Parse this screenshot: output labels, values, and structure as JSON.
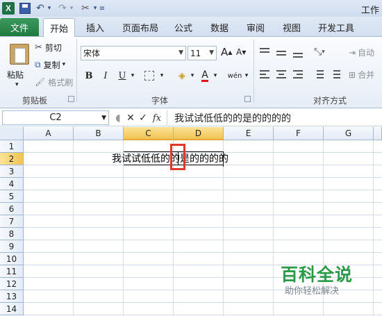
{
  "window": {
    "title": "工作"
  },
  "app_icon": "excel-logo",
  "quick_access": {
    "save": "save-icon",
    "undo": "undo-icon",
    "redo": "redo-icon",
    "tools": "tools-icon",
    "customize": "customize-icon"
  },
  "tabs": [
    {
      "label": "文件"
    },
    {
      "label": "开始"
    },
    {
      "label": "插入"
    },
    {
      "label": "页面布局"
    },
    {
      "label": "公式"
    },
    {
      "label": "数据"
    },
    {
      "label": "审阅"
    },
    {
      "label": "视图"
    },
    {
      "label": "开发工具"
    }
  ],
  "ribbon": {
    "clipboard": {
      "paste_label": "粘贴",
      "cut_label": "剪切",
      "copy_label": "复制",
      "format_painter_label": "格式刷",
      "group_label": "剪贴板"
    },
    "font": {
      "font_name": "宋体",
      "font_size": "11",
      "grow_label": "A",
      "shrink_label": "A",
      "bold": "B",
      "italic": "I",
      "underline": "U",
      "font_color": "A",
      "wen": "wén",
      "group_label": "字体"
    },
    "alignment": {
      "wrap_label": "自动",
      "merge_label": "合并",
      "group_label": "对齐方式"
    }
  },
  "formula_bar": {
    "name_box": "C2",
    "cancel": "✕",
    "enter": "✓",
    "fx": "fx",
    "content": "我试试低低的的是的的的的"
  },
  "grid": {
    "columns": [
      "A",
      "B",
      "C",
      "D",
      "E",
      "F",
      "G"
    ],
    "rows": [
      "1",
      "2",
      "3",
      "4",
      "5",
      "6",
      "7",
      "8",
      "9",
      "10",
      "11",
      "12",
      "13",
      "14"
    ],
    "active_cell": "C2",
    "cell_value": "我试试低低的的是的的的的"
  },
  "watermark": {
    "title": "百科全说",
    "subtitle": "助你轻松解决"
  },
  "colors": {
    "file_tab": "#1f7a40",
    "selected_header": "#f1c453",
    "highlight_box": "#e0372c",
    "watermark": "#2a9a48"
  }
}
